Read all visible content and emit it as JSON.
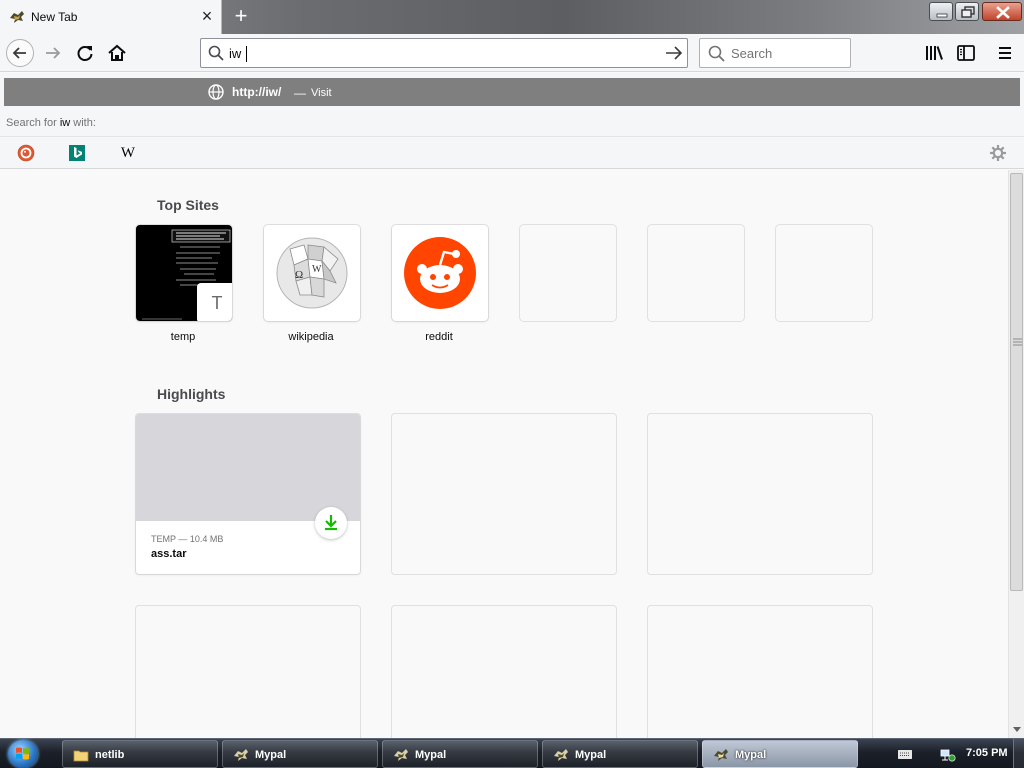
{
  "window": {
    "tab_title": "New Tab",
    "new_tab_symbol": "+",
    "close_symbol": "×"
  },
  "navbar": {
    "url_value": "iw",
    "search_placeholder": "Search"
  },
  "urlbar_dropdown": {
    "suggestion_url": "http://iw/",
    "suggestion_separator": "—",
    "suggestion_action": "Visit",
    "search_with_prefix": "Search for ",
    "search_term": "iw",
    "search_with_suffix": " with:",
    "engines": [
      "duckduckgo-icon",
      "bing-icon",
      "wikipedia-icon"
    ],
    "wikipedia_glyph": "W"
  },
  "newtab": {
    "top_sites_title": "Top Sites",
    "top_sites": [
      {
        "label": "temp",
        "badge": "T"
      },
      {
        "label": "wikipedia"
      },
      {
        "label": "reddit"
      }
    ],
    "highlights_title": "Highlights",
    "highlight": {
      "meta": "TEMP — 10.4 MB",
      "title": "ass.tar"
    }
  },
  "taskbar": {
    "items": [
      {
        "label": "netlib",
        "icon": "folder-icon"
      },
      {
        "label": "Mypal",
        "icon": "mypal-icon"
      },
      {
        "label": "Mypal",
        "icon": "mypal-icon"
      },
      {
        "label": "Mypal",
        "icon": "mypal-icon"
      },
      {
        "label": "Mypal",
        "icon": "mypal-icon",
        "active": true
      }
    ],
    "clock": "7:05 PM"
  },
  "colors": {
    "reddit": "#ff4500",
    "download_green": "#12bc00",
    "bing": "#008373",
    "duckduckgo": "#de5833"
  }
}
